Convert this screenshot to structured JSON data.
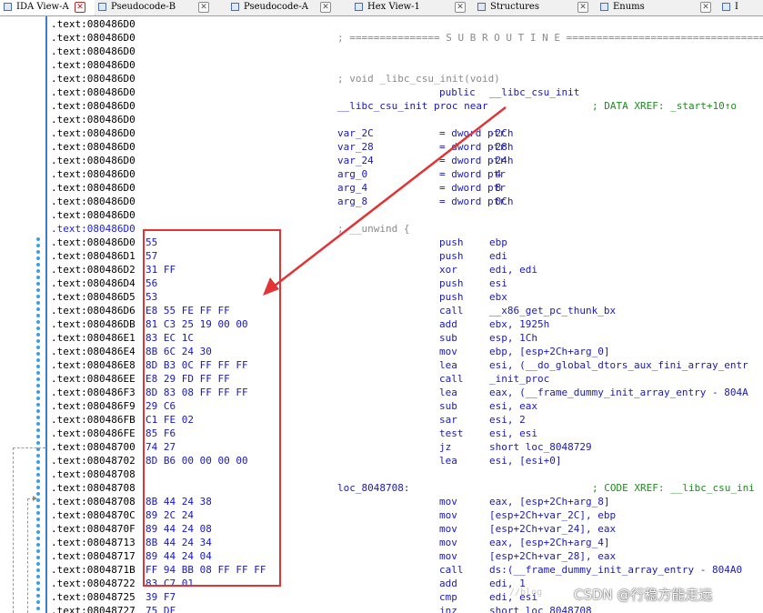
{
  "tabs": [
    {
      "label": "IDA View-A",
      "active": true,
      "icon": "ida-view-icon"
    },
    {
      "label": "Pseudocode-B",
      "active": false,
      "icon": "pseudocode-icon"
    },
    {
      "label": "Pseudocode-A",
      "active": false,
      "icon": "pseudocode-icon"
    },
    {
      "label": "Hex View-1",
      "active": false,
      "icon": "hex-view-icon"
    },
    {
      "label": "Structures",
      "active": false,
      "icon": "structures-icon"
    },
    {
      "label": "Enums",
      "active": false,
      "icon": "enums-icon"
    },
    {
      "label": "I",
      "active": false,
      "icon": "imports-icon"
    }
  ],
  "close_glyph": "✕",
  "rows": [
    {
      "addr": ".text:080486D0",
      "bytes": "",
      "label": "",
      "mnem": "",
      "ops": "",
      "note": ""
    },
    {
      "addr": ".text:080486D0",
      "bytes": "",
      "label": "; =============== S U B R O U T I N E =======================================",
      "mnem": "",
      "ops": "",
      "note": ""
    },
    {
      "addr": ".text:080486D0",
      "bytes": "",
      "label": "",
      "mnem": "",
      "ops": "",
      "note": ""
    },
    {
      "addr": ".text:080486D0",
      "bytes": "",
      "label": "",
      "mnem": "",
      "ops": "",
      "note": ""
    },
    {
      "addr": ".text:080486D0",
      "bytes": "",
      "label": "; void _libc_csu_init(void)",
      "mnem": "",
      "ops": "",
      "note": ""
    },
    {
      "addr": ".text:080486D0",
      "bytes": "",
      "label": "",
      "mnem": "public",
      "ops": "__libc_csu_init",
      "note": ""
    },
    {
      "addr": ".text:080486D0",
      "bytes": "",
      "label": "__libc_csu_init proc near",
      "mnem": "",
      "ops": "",
      "note": "; DATA XREF: _start+10↑o"
    },
    {
      "addr": ".text:080486D0",
      "bytes": "",
      "label": "",
      "mnem": "",
      "ops": "",
      "note": ""
    },
    {
      "addr": ".text:080486D0",
      "bytes": "",
      "label": "var_2C",
      "mnem": "= dword ptr",
      "ops": "-2Ch",
      "note": ""
    },
    {
      "addr": ".text:080486D0",
      "bytes": "",
      "label": "var_28",
      "mnem": "= dword ptr",
      "ops": "-28h",
      "note": ""
    },
    {
      "addr": ".text:080486D0",
      "bytes": "",
      "label": "var_24",
      "mnem": "= dword ptr",
      "ops": "-24h",
      "note": ""
    },
    {
      "addr": ".text:080486D0",
      "bytes": "",
      "label": "arg_0",
      "mnem": "= dword ptr",
      "ops": " 4",
      "note": ""
    },
    {
      "addr": ".text:080486D0",
      "bytes": "",
      "label": "arg_4",
      "mnem": "= dword ptr",
      "ops": " 8",
      "note": ""
    },
    {
      "addr": ".text:080486D0",
      "bytes": "",
      "label": "arg_8",
      "mnem": "= dword ptr",
      "ops": " 0Ch",
      "note": ""
    },
    {
      "addr": ".text:080486D0",
      "bytes": "",
      "label": "",
      "mnem": "",
      "ops": "",
      "note": ""
    },
    {
      "addr": ".text:080486D0",
      "bytes": "",
      "label": "; __unwind {",
      "mnem": "",
      "ops": "",
      "note": ""
    },
    {
      "addr": ".text:080486D0",
      "bytes": "55",
      "label": "",
      "mnem": "push",
      "ops": "ebp",
      "note": ""
    },
    {
      "addr": ".text:080486D1",
      "bytes": "57",
      "label": "",
      "mnem": "push",
      "ops": "edi",
      "note": ""
    },
    {
      "addr": ".text:080486D2",
      "bytes": "31 FF",
      "label": "",
      "mnem": "xor",
      "ops": "edi, edi",
      "note": ""
    },
    {
      "addr": ".text:080486D4",
      "bytes": "56",
      "label": "",
      "mnem": "push",
      "ops": "esi",
      "note": ""
    },
    {
      "addr": ".text:080486D5",
      "bytes": "53",
      "label": "",
      "mnem": "push",
      "ops": "ebx",
      "note": ""
    },
    {
      "addr": ".text:080486D6",
      "bytes": "E8 55 FE FF FF",
      "label": "",
      "mnem": "call",
      "ops": "__x86_get_pc_thunk_bx",
      "note": ""
    },
    {
      "addr": ".text:080486DB",
      "bytes": "81 C3 25 19 00 00",
      "label": "",
      "mnem": "add",
      "ops": "ebx, 1925h",
      "note": ""
    },
    {
      "addr": ".text:080486E1",
      "bytes": "83 EC 1C",
      "label": "",
      "mnem": "sub",
      "ops": "esp, 1Ch",
      "note": ""
    },
    {
      "addr": ".text:080486E4",
      "bytes": "8B 6C 24 30",
      "label": "",
      "mnem": "mov",
      "ops": "ebp, [esp+2Ch+arg_0]",
      "note": ""
    },
    {
      "addr": ".text:080486E8",
      "bytes": "8D B3 0C FF FF FF",
      "label": "",
      "mnem": "lea",
      "ops": "esi, (__do_global_dtors_aux_fini_array_entr",
      "note": ""
    },
    {
      "addr": ".text:080486EE",
      "bytes": "E8 29 FD FF FF",
      "label": "",
      "mnem": "call",
      "ops": "_init_proc",
      "note": ""
    },
    {
      "addr": ".text:080486F3",
      "bytes": "8D 83 08 FF FF FF",
      "label": "",
      "mnem": "lea",
      "ops": "eax, (__frame_dummy_init_array_entry - 804A",
      "note": ""
    },
    {
      "addr": ".text:080486F9",
      "bytes": "29 C6",
      "label": "",
      "mnem": "sub",
      "ops": "esi, eax",
      "note": ""
    },
    {
      "addr": ".text:080486FB",
      "bytes": "C1 FE 02",
      "label": "",
      "mnem": "sar",
      "ops": "esi, 2",
      "note": ""
    },
    {
      "addr": ".text:080486FE",
      "bytes": "85 F6",
      "label": "",
      "mnem": "test",
      "ops": "esi, esi",
      "note": ""
    },
    {
      "addr": ".text:08048700",
      "bytes": "74 27",
      "label": "",
      "mnem": "jz",
      "ops": "short loc_8048729",
      "note": ""
    },
    {
      "addr": ".text:08048702",
      "bytes": "8D B6 00 00 00 00",
      "label": "",
      "mnem": "lea",
      "ops": "esi, [esi+0]",
      "note": ""
    },
    {
      "addr": ".text:08048708",
      "bytes": "",
      "label": "",
      "mnem": "",
      "ops": "",
      "note": ""
    },
    {
      "addr": ".text:08048708",
      "bytes": "",
      "label": "loc_8048708:",
      "mnem": "",
      "ops": "",
      "note": "; CODE XREF: __libc_csu_ini"
    },
    {
      "addr": ".text:08048708",
      "bytes": "8B 44 24 38",
      "label": "",
      "mnem": "mov",
      "ops": "eax, [esp+2Ch+arg_8]",
      "note": ""
    },
    {
      "addr": ".text:0804870C",
      "bytes": "89 2C 24",
      "label": "",
      "mnem": "mov",
      "ops": "[esp+2Ch+var_2C], ebp",
      "note": ""
    },
    {
      "addr": ".text:0804870F",
      "bytes": "89 44 24 08",
      "label": "",
      "mnem": "mov",
      "ops": "[esp+2Ch+var_24], eax",
      "note": ""
    },
    {
      "addr": ".text:08048713",
      "bytes": "8B 44 24 34",
      "label": "",
      "mnem": "mov",
      "ops": "eax, [esp+2Ch+arg_4]",
      "note": ""
    },
    {
      "addr": ".text:08048717",
      "bytes": "89 44 24 04",
      "label": "",
      "mnem": "mov",
      "ops": "[esp+2Ch+var_28], eax",
      "note": ""
    },
    {
      "addr": ".text:0804871B",
      "bytes": "FF 94 BB 08 FF FF FF",
      "label": "",
      "mnem": "call",
      "ops": "ds:(__frame_dummy_init_array_entry - 804A0",
      "note": ""
    },
    {
      "addr": ".text:08048722",
      "bytes": "83 C7 01",
      "label": "",
      "mnem": "add",
      "ops": "edi, 1",
      "note": ""
    },
    {
      "addr": ".text:08048725",
      "bytes": "39 F7",
      "label": "",
      "mnem": "cmp",
      "ops": "edi, esi",
      "note": ""
    },
    {
      "addr": ".text:08048727",
      "bytes": "75 DF",
      "label": "",
      "mnem": "jnz",
      "ops": "short loc_8048708",
      "note": ""
    }
  ],
  "watermark": "CSDN @行稳方能走远",
  "watermark_faint": "//blog",
  "colors": {
    "annotation": "#e23434",
    "code_blue": "#1a1ab4",
    "comment_green": "#1e8c1e",
    "gutter_dot": "#3aa0e6"
  }
}
